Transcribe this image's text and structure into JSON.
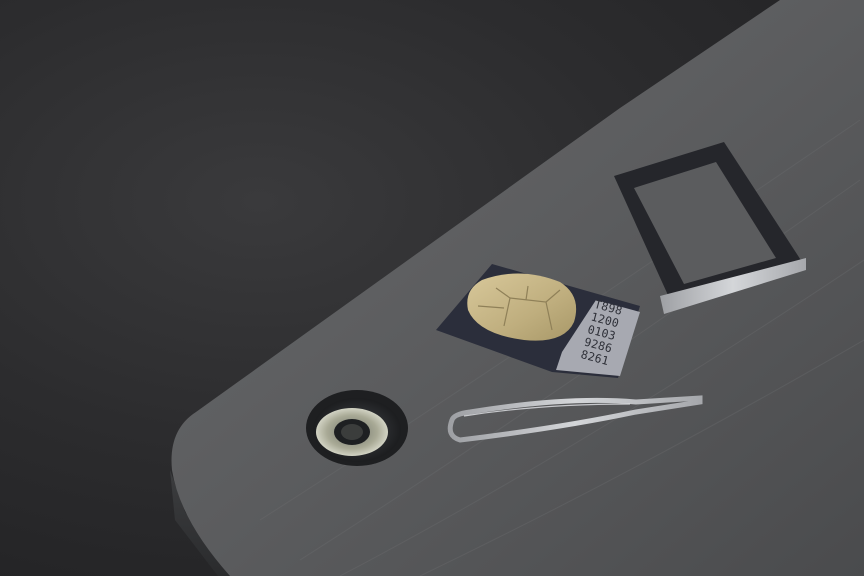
{
  "scene": {
    "sim_card": {
      "printed_lines": [
        "T898",
        "1200",
        "0103",
        "9286",
        "8261"
      ]
    },
    "objects": [
      "table-surface",
      "sim-card",
      "sim-tray",
      "eject-pin",
      "mounting-hole"
    ],
    "colors": {
      "background": "#2c2c2e",
      "table": "#5c5d5f",
      "sim_body": "#2a2d3a",
      "chip_gold": "#c9b98c",
      "tray_metal": "#b4b6ba",
      "pin_metal": "#c8cacd"
    }
  }
}
